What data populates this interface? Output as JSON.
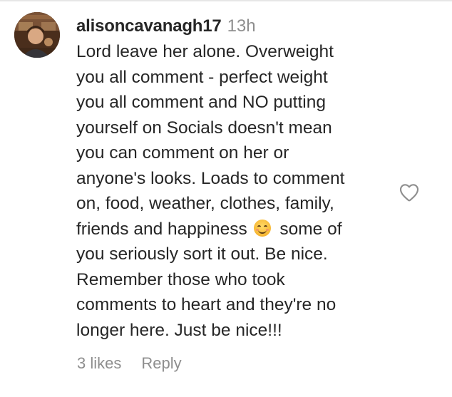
{
  "comment": {
    "username": "alisoncavanagh17",
    "time": "13h",
    "text_lines": [
      "Lord leave her alone. Overweight",
      "you all comment - perfect weight",
      "you all comment and NO putting",
      "yourself on Socials doesn't mean",
      "you can comment on her or",
      "anyone's looks. Loads to comment",
      "on, food, weather, clothes, family,",
      "friends and happiness",
      "some of",
      "you seriously sort it out. Be nice.",
      "Remember those who took",
      "comments to heart and they're no",
      "longer here. Just be nice!!!"
    ],
    "emoji": "smiling-face-emoji",
    "likes": "3 likes",
    "reply": "Reply"
  },
  "icons": {
    "like": "heart-outline-icon",
    "avatar": "user-avatar"
  },
  "colors": {
    "text": "#262626",
    "secondary": "#8e8e8e",
    "background": "#ffffff"
  }
}
